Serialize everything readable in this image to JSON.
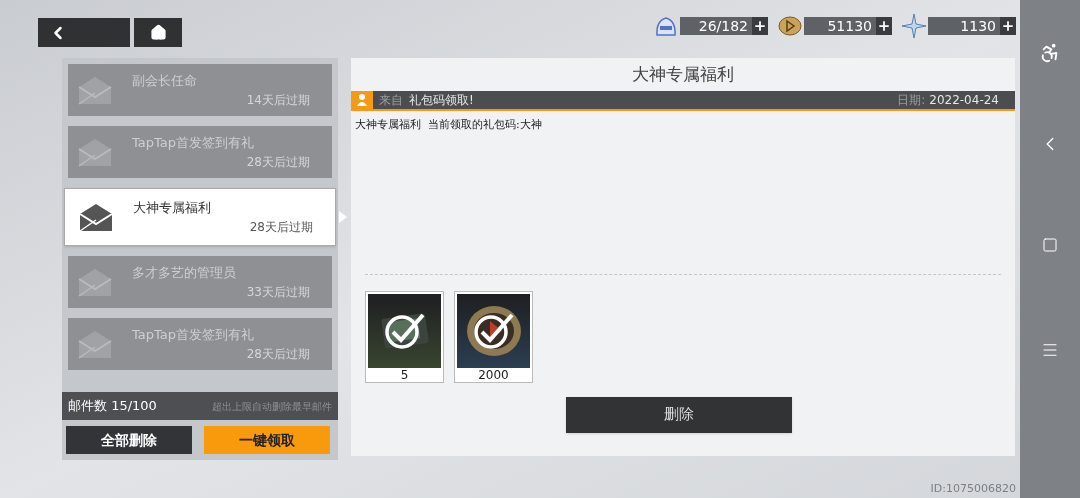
{
  "resources": [
    {
      "kind": "stamina",
      "value": "26/182"
    },
    {
      "kind": "coin",
      "value": "51130"
    },
    {
      "kind": "crystal",
      "value": "1130"
    }
  ],
  "mails": [
    {
      "title": "副会长任命",
      "expiry": "14天后过期",
      "selected": false
    },
    {
      "title": "TapTap首发签到有礼",
      "expiry": "28天后过期",
      "selected": false
    },
    {
      "title": "大神专属福利",
      "expiry": "28天后过期",
      "selected": true
    },
    {
      "title": "多才多艺的管理员",
      "expiry": "33天后过期",
      "selected": false
    },
    {
      "title": "TapTap首发签到有礼",
      "expiry": "28天后过期",
      "selected": false
    }
  ],
  "mail_count": {
    "label": "邮件数 15/100",
    "note": "超出上限自动删除最早邮件"
  },
  "list_buttons": {
    "delete_all": "全部删除",
    "claim_all": "一键领取"
  },
  "mail": {
    "title": "大神专属福利",
    "from_label": "来自",
    "from": "礼包码领取!",
    "date_label": "日期:",
    "date": "2022-04-24",
    "body": "大神专属福利  当前领取的礼包码:大神",
    "rewards": [
      {
        "kind": "card",
        "count": "5",
        "claimed": true
      },
      {
        "kind": "medal",
        "count": "2000",
        "claimed": true
      }
    ],
    "delete_button": "删除"
  },
  "player_id": "ID:1075006820"
}
